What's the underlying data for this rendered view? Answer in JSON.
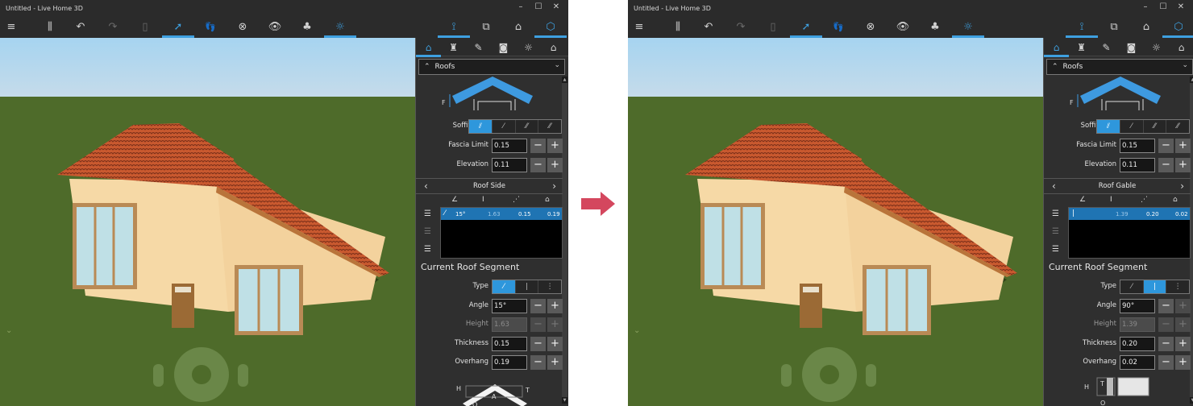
{
  "colors": {
    "accent": "#3ea0e0",
    "transition_arrow": "#d4475e",
    "roof_tile": "#c4532e",
    "wall": "#f6d7a2",
    "ground": "#4e6b2a",
    "sky": "#a6d4f0"
  },
  "transition_arrow_icon": "arrow-right-icon",
  "screens": [
    {
      "id": "before",
      "window_title": "Untitled - Live Home 3D",
      "window_controls": {
        "minimize": "–",
        "maximize": "☐",
        "close": "✕"
      },
      "toolbar": {
        "menu": "≡",
        "library": "⫼",
        "undo": "↶",
        "redo": "↷",
        "delete": "▯",
        "select": "➚",
        "walk": "👣",
        "orbit": "⊗",
        "view": "👁",
        "material": "♣",
        "light": "☼",
        "view_2d_elev": "⟟",
        "floor_plan": "⧉",
        "view_3d_house": "⌂",
        "view_3d": "⬡"
      },
      "panel_tabs": [
        "roof-props",
        "object",
        "edit",
        "camera",
        "light",
        "building"
      ],
      "panel_tab_icons": [
        "⌂",
        "♜",
        "✎",
        "◙",
        "☼",
        "⌂"
      ],
      "element_type": "Roofs",
      "diagram_top_label": "F",
      "soffit_type": {
        "label": "Soffit Type",
        "options": [
          "⫽",
          "⁄",
          "⁄⁄",
          "⁄⁄"
        ],
        "selected": 0
      },
      "fascia_limit": {
        "label": "Fascia Limit",
        "value": "0.15"
      },
      "elevation": {
        "label": "Elevation",
        "value": "0.11"
      },
      "nav_title": "Roof Side",
      "nav_prev": "‹",
      "nav_next": "›",
      "segment_columns_icons": [
        "∠",
        "Ⅰ",
        "⋰",
        "⌂"
      ],
      "segments": [
        {
          "type_glyph": "⁄",
          "angle": "15°",
          "height": "1.63",
          "thickness": "0.15",
          "overhang": "0.19"
        }
      ],
      "current_segment": {
        "title": "Current Roof Segment",
        "type": {
          "label": "Type",
          "options": [
            "⁄",
            "|",
            "⋮"
          ],
          "selected": 0
        },
        "angle": {
          "label": "Angle",
          "value": "15°",
          "enabled": true
        },
        "height": {
          "label": "Height",
          "value": "1.63",
          "enabled": false
        },
        "thickness": {
          "label": "Thickness",
          "value": "0.15",
          "enabled": true
        },
        "overhang": {
          "label": "Overhang",
          "value": "0.19",
          "enabled": true
        }
      },
      "bottom_diagram_labels": [
        "H",
        "A",
        "T",
        "O"
      ]
    },
    {
      "id": "after",
      "window_title": "Untitled - Live Home 3D",
      "window_controls": {
        "minimize": "–",
        "maximize": "☐",
        "close": "✕"
      },
      "toolbar": {
        "menu": "≡",
        "library": "⫼",
        "undo": "↶",
        "redo": "↷",
        "delete": "▯",
        "select": "➚",
        "walk": "👣",
        "orbit": "⊗",
        "view": "👁",
        "material": "♣",
        "light": "☼",
        "view_2d_elev": "⟟",
        "floor_plan": "⧉",
        "view_3d_house": "⌂",
        "view_3d": "⬡"
      },
      "panel_tabs": [
        "roof-props",
        "object",
        "edit",
        "camera",
        "light",
        "building"
      ],
      "panel_tab_icons": [
        "⌂",
        "♜",
        "✎",
        "◙",
        "☼",
        "⌂"
      ],
      "element_type": "Roofs",
      "diagram_top_label": "F",
      "soffit_type": {
        "label": "Soffit Type",
        "options": [
          "⫽",
          "⁄",
          "⁄⁄",
          "⁄⁄"
        ],
        "selected": 0
      },
      "fascia_limit": {
        "label": "Fascia Limit",
        "value": "0.15"
      },
      "elevation": {
        "label": "Elevation",
        "value": "0.11"
      },
      "nav_title": "Roof Gable",
      "nav_prev": "‹",
      "nav_next": "›",
      "segment_columns_icons": [
        "∠",
        "Ⅰ",
        "⋰",
        "⌂"
      ],
      "segments": [
        {
          "type_glyph": "|",
          "angle": "",
          "height": "1.39",
          "thickness": "0.20",
          "overhang": "0.02"
        }
      ],
      "current_segment": {
        "title": "Current Roof Segment",
        "type": {
          "label": "Type",
          "options": [
            "⁄",
            "|",
            "⋮"
          ],
          "selected": 1
        },
        "angle": {
          "label": "Angle",
          "value": "90°",
          "enabled": true
        },
        "height": {
          "label": "Height",
          "value": "1.39",
          "enabled": false
        },
        "thickness": {
          "label": "Thickness",
          "value": "0.20",
          "enabled": true
        },
        "overhang": {
          "label": "Overhang",
          "value": "0.02",
          "enabled": true
        }
      },
      "bottom_diagram_labels": [
        "H",
        "T",
        "O"
      ]
    }
  ]
}
